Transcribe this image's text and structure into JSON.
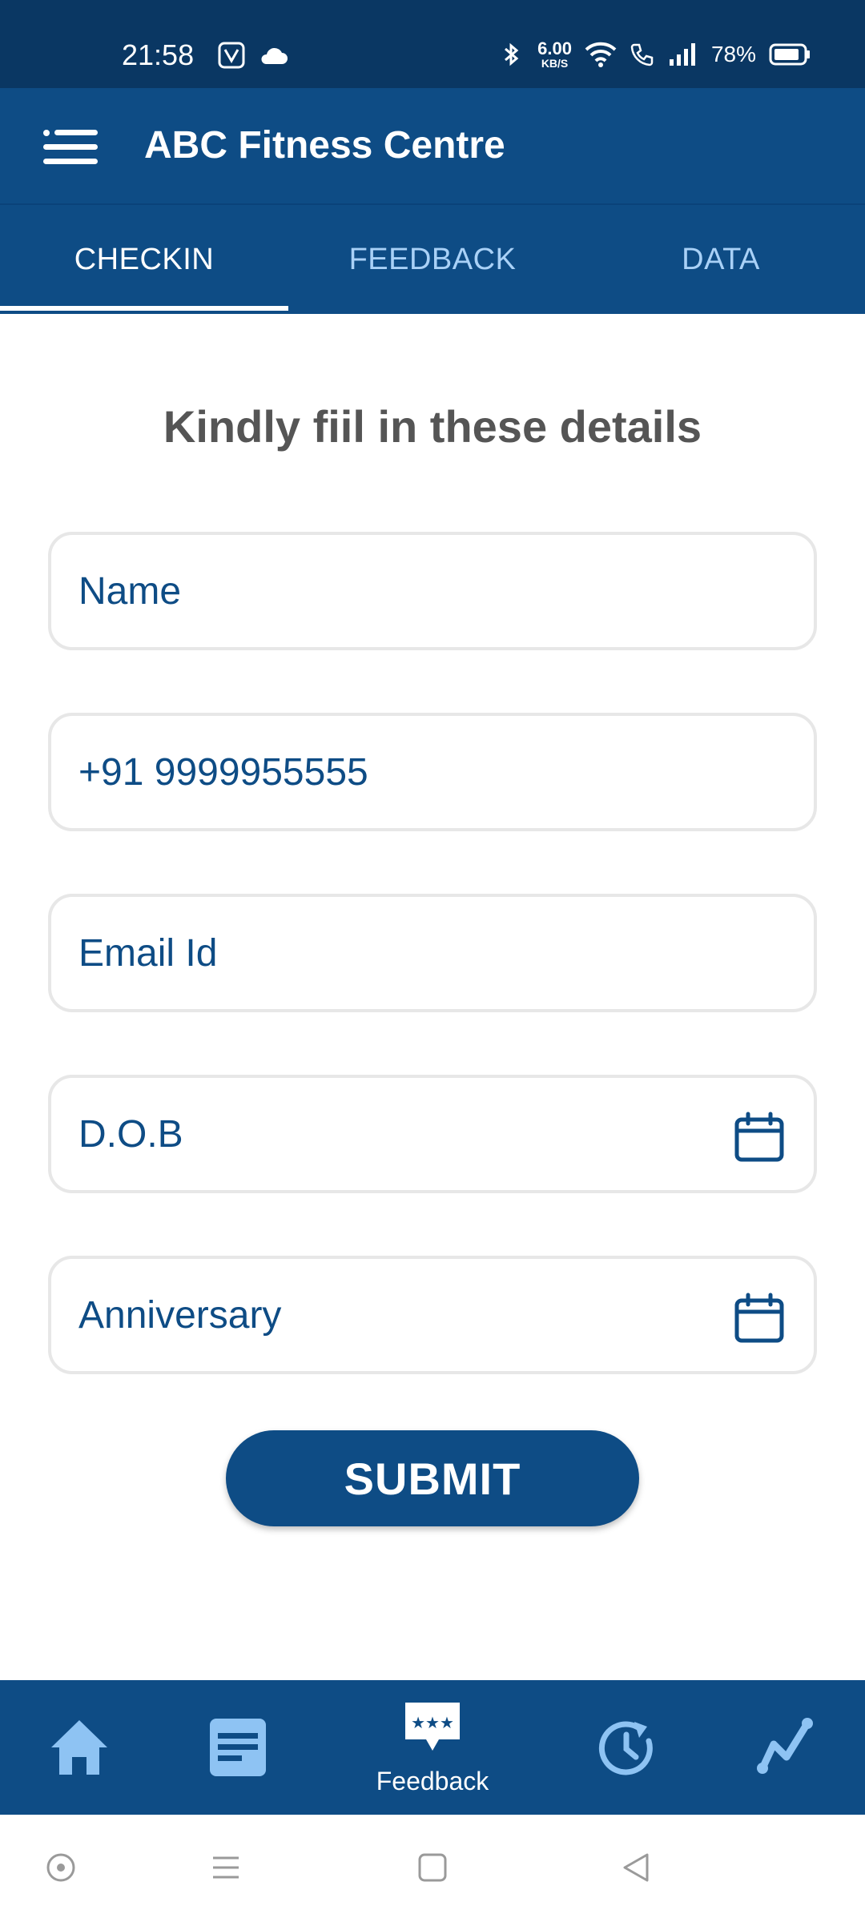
{
  "status_bar": {
    "time": "21:58",
    "net_speed_value": "6.00",
    "net_speed_unit": "KB/S",
    "battery": "78%"
  },
  "app_bar": {
    "title": "ABC Fitness Centre",
    "menu_icon": "hamburger-menu-icon"
  },
  "tabs": [
    {
      "label": "CHECKIN",
      "active": true
    },
    {
      "label": "FEEDBACK",
      "active": false
    },
    {
      "label": "DATA",
      "active": false
    }
  ],
  "form": {
    "heading": "Kindly fiil in these details",
    "fields": {
      "name": "Name",
      "phone": "+91 9999955555",
      "email": "Email Id",
      "dob": "D.O.B",
      "anniversary": "Anniversary"
    },
    "submit_label": "SUBMIT"
  },
  "bottom_nav": {
    "items": [
      {
        "icon": "home-icon"
      },
      {
        "icon": "list-icon"
      },
      {
        "icon": "feedback-icon",
        "label": "Feedback"
      },
      {
        "icon": "history-icon"
      },
      {
        "icon": "analytics-icon"
      }
    ]
  },
  "colors": {
    "primary": "#0e4c85",
    "status_bar": "#0a3763",
    "inactive_tab": "#a9d1f7",
    "nav_icon": "#8ec3f3"
  }
}
